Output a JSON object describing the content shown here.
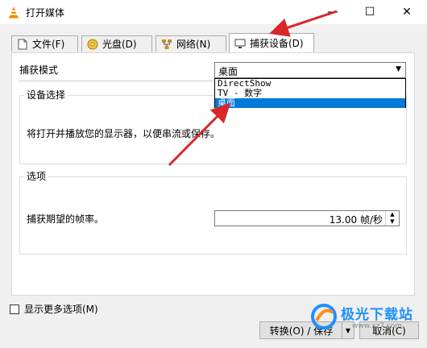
{
  "window": {
    "title": "打开媒体",
    "minimize_glyph": "—",
    "maximize_glyph": "☐",
    "close_glyph": "✕"
  },
  "tabs": [
    {
      "label": "文件(F)",
      "icon": "file-icon"
    },
    {
      "label": "光盘(D)",
      "icon": "disc-icon"
    },
    {
      "label": "网络(N)",
      "icon": "network-icon"
    },
    {
      "label": "捕获设备(D)",
      "icon": "capture-device-icon",
      "active": true
    }
  ],
  "capture": {
    "mode_label": "捕获模式",
    "mode_value": "桌面",
    "mode_options": [
      "DirectShow",
      "TV - 数字",
      "桌面"
    ],
    "selected_option": "桌面"
  },
  "device": {
    "legend": "设备选择",
    "text": "将打开并播放您的显示器，以便串流或保存。"
  },
  "options": {
    "legend": "选项",
    "fps_label": "捕获期望的帧率。",
    "fps_value": "13.00 帧/秒"
  },
  "footer": {
    "more_options": "显示更多选项(M)",
    "more_checked": false,
    "convert_label": "转换(O) / 保存",
    "cancel_label": "取消(C)"
  },
  "watermark": {
    "text": "极光下载站",
    "url": "www.xz7.com"
  },
  "colors": {
    "accent": "#0078d7",
    "annotation_arrow": "#d9262b"
  }
}
